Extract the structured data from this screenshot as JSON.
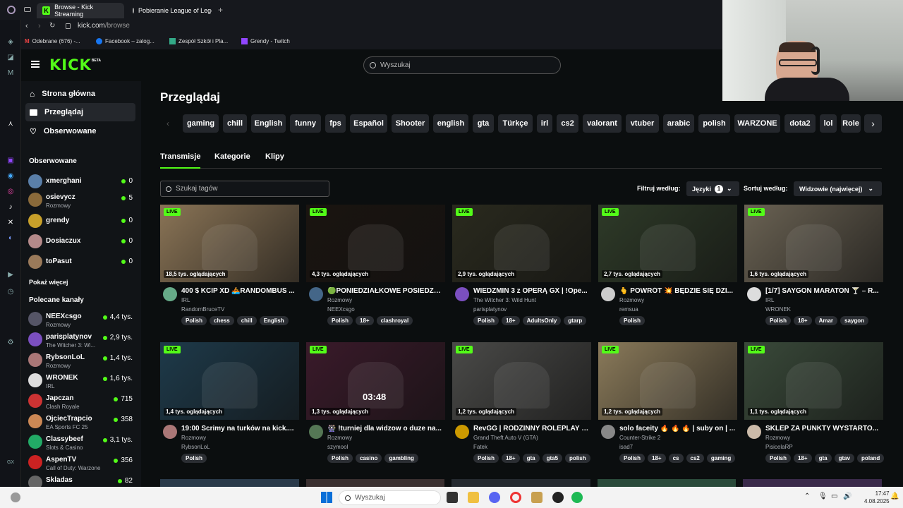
{
  "browser": {
    "tabs": [
      {
        "label": "Browse - Kick Streaming",
        "active": true
      },
      {
        "label": "Pobieranie League of Legends",
        "active": false
      }
    ],
    "url_host": "kick.com",
    "url_path": "/browse",
    "bookmarks": [
      "Odebrane (676) -...",
      "Facebook – zalog...",
      "Zespół Szkół i Pla...",
      "Grendy - Twitch"
    ]
  },
  "header": {
    "logo": "KICK",
    "logo_badge": "BETA",
    "search_placeholder": "Wyszukaj"
  },
  "sidebar": {
    "nav": [
      {
        "label": "Strona główna",
        "icon": "home-icon"
      },
      {
        "label": "Przeglądaj",
        "icon": "browse-icon",
        "active": true
      },
      {
        "label": "Obserwowane",
        "icon": "heart-icon"
      }
    ],
    "followed_title": "Obserwowane",
    "followed": [
      {
        "name": "xmerghani",
        "sub": "",
        "count": "0",
        "color": "#5a7fa8"
      },
      {
        "name": "osievycz",
        "sub": "Rozmowy",
        "count": "5",
        "color": "#8a6a3a"
      },
      {
        "name": "grendy",
        "sub": "",
        "count": "0",
        "color": "#c8a02a"
      },
      {
        "name": "Dosiaczux",
        "sub": "",
        "count": "0",
        "color": "#b58a8a"
      },
      {
        "name": "toPasut",
        "sub": "",
        "count": "0",
        "color": "#9a7a5a"
      }
    ],
    "show_more": "Pokaż więcej",
    "recommended_title": "Polecane kanały",
    "recommended": [
      {
        "name": "NEEXcsgo",
        "sub": "Rozmowy",
        "count": "4,4 tys.",
        "color": "#556"
      },
      {
        "name": "parisplatynov",
        "sub": "The Witcher 3: Wi...",
        "count": "2,9 tys.",
        "color": "#7b4fc0"
      },
      {
        "name": "RybsonLoL",
        "sub": "Rozmowy",
        "count": "1,4 tys.",
        "color": "#a77"
      },
      {
        "name": "WRONEK",
        "sub": "IRL",
        "count": "1,6 tys.",
        "color": "#ddd"
      },
      {
        "name": "Japczan",
        "sub": "Clash Royale",
        "count": "715",
        "color": "#c33"
      },
      {
        "name": "OjciecTrapcio",
        "sub": "EA Sports FC 25",
        "count": "358",
        "color": "#c85"
      },
      {
        "name": "Classybeef",
        "sub": "Slots & Casino",
        "count": "3,1 tys.",
        "color": "#2a6"
      },
      {
        "name": "AspenTV",
        "sub": "Call of Duty: Warzone",
        "count": "356",
        "color": "#c22"
      },
      {
        "name": "Skladas",
        "sub": "",
        "count": "82",
        "color": "#666"
      }
    ]
  },
  "main": {
    "title": "Przeglądaj",
    "categories": [
      "gaming",
      "chill",
      "English",
      "funny",
      "fps",
      "Español",
      "Shooter",
      "english",
      "gta",
      "Türkçe",
      "irl",
      "cs2",
      "valorant",
      "vtuber",
      "arabic",
      "polish",
      "WARZONE",
      "dota2",
      "lol",
      "Role"
    ],
    "tabs": [
      "Transmisje",
      "Kategorie",
      "Klipy"
    ],
    "tag_search_placeholder": "Szukaj tagów",
    "filter_label": "Filtruj według:",
    "filter_value": "Języki",
    "filter_count": "1",
    "sort_label": "Sortuj według:",
    "sort_value": "Widzowie (najwięcej)",
    "live_label": "LIVE",
    "streams": [
      {
        "viewers": "18,5 tys. oglądających",
        "title": "400 $ KCIP XD 🚣RANDOMBUS ...",
        "category": "IRL",
        "channel": "RandomBruceTV",
        "tags": [
          "Polish",
          "chess",
          "chill",
          "English"
        ],
        "bg": "#8a7456",
        "av": "#6a8"
      },
      {
        "viewers": "4,3 tys. oglądających",
        "title": "🟢PONIEDZIAŁKOWE POSIEDZE...",
        "category": "Rozmowy",
        "channel": "NEEXcsgo",
        "tags": [
          "Polish",
          "18+",
          "clashroyal"
        ],
        "bg": "#1a1410",
        "av": "#468"
      },
      {
        "viewers": "2,9 tys. oglądających",
        "title": "WIEDZMIN 3 z OPERĄ GX | !Ope...",
        "category": "The Witcher 3: Wild Hunt",
        "channel": "parisplatynov",
        "tags": [
          "Polish",
          "18+",
          "AdultsOnly",
          "gtarp"
        ],
        "bg": "#2a2a1e",
        "av": "#7b4fc0"
      },
      {
        "viewers": "2,7 tys. oglądających",
        "title": "🫰 POWRÓT 💥 BĘDZIE SIĘ DZI...",
        "category": "Rozmowy",
        "channel": "remsua",
        "tags": [
          "Polish"
        ],
        "bg": "#2e3a28",
        "av": "#ccc"
      },
      {
        "viewers": "1,6 tys. oglądających",
        "title": "[1/7] SAYGON MARATON 🍸 – R...",
        "category": "IRL",
        "channel": "WRONEK",
        "tags": [
          "Polish",
          "18+",
          "Amar",
          "saygon"
        ],
        "bg": "#6a6253",
        "av": "#ddd"
      },
      {
        "viewers": "1,4 tys. oglądających",
        "title": "19:00 Scrimy na turków na kick....",
        "category": "Rozmowy",
        "channel": "RybsonLoL",
        "tags": [
          "Polish"
        ],
        "bg": "#1e3a4a",
        "av": "#a77"
      },
      {
        "viewers": "1,3 tys. oglądających",
        "title": "🎡 !turniej dla widzow o duze na...",
        "category": "Rozmowy",
        "channel": "szymool",
        "tags": [
          "Polish",
          "casino",
          "gambling"
        ],
        "bg": "#3a1a2a",
        "av": "#575",
        "overlay": "03:48"
      },
      {
        "viewers": "1,2 tys. oglądających",
        "title": "RevGG | RODZINNY ROLEPLAY | ...",
        "category": "Grand Theft Auto V (GTA)",
        "channel": "Fatek",
        "tags": [
          "Polish",
          "18+",
          "gta",
          "gta5",
          "polish"
        ],
        "bg": "#4a4a48",
        "av": "#c90"
      },
      {
        "viewers": "1,2 tys. oglądających",
        "title": "solo faceity 🔥 🔥 🔥 | suby on | ...",
        "category": "Counter-Strike 2",
        "channel": "isad7",
        "tags": [
          "Polish",
          "18+",
          "cs",
          "cs2",
          "gaming"
        ],
        "bg": "#8a7a5a",
        "av": "#888"
      },
      {
        "viewers": "1,1 tys. oglądających",
        "title": "SKLEP ZA PUNKTY WYSTARTO...",
        "category": "Rozmowy",
        "channel": "PisicelaRP",
        "tags": [
          "Polish",
          "18+",
          "gta",
          "gtav",
          "poland"
        ],
        "bg": "#3a4a3a",
        "av": "#cba"
      }
    ]
  },
  "taskbar": {
    "search": "Wyszukaj",
    "time": "17:47",
    "date": "4.08.2025"
  },
  "colors": {
    "accent": "#53fc18",
    "bg": "#0b0e0f",
    "panel": "#111417"
  }
}
